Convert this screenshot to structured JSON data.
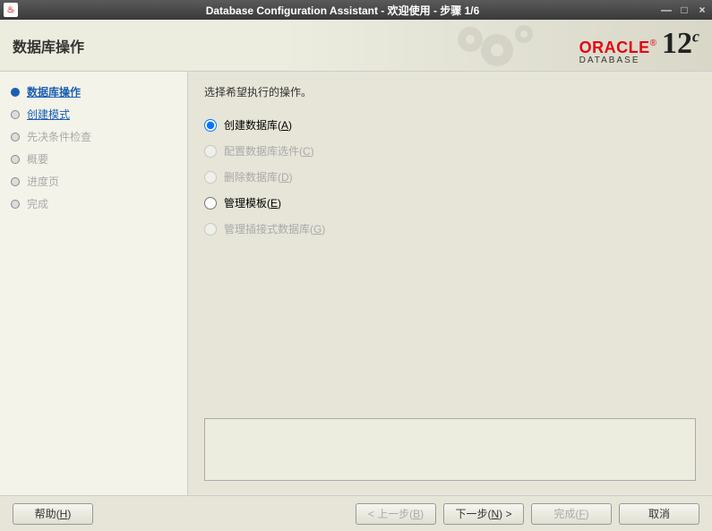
{
  "window": {
    "title": "Database Configuration Assistant - 欢迎使用 - 步骤 1/6"
  },
  "header": {
    "page_title": "数据库操作",
    "oracle": "ORACLE",
    "oracle_sub": "DATABASE",
    "version": "12",
    "version_sup": "c"
  },
  "sidebar": {
    "steps": [
      {
        "label": "数据库操作",
        "state": "active"
      },
      {
        "label": "创建模式",
        "state": "link"
      },
      {
        "label": "先决条件检查",
        "state": "disabled"
      },
      {
        "label": "概要",
        "state": "disabled"
      },
      {
        "label": "进度页",
        "state": "disabled"
      },
      {
        "label": "完成",
        "state": "disabled"
      }
    ]
  },
  "content": {
    "instruction": "选择希望执行的操作。",
    "options": [
      {
        "label": "创建数据库(",
        "key": "A",
        "tail": ")",
        "enabled": true,
        "selected": true
      },
      {
        "label": "配置数据库选件(",
        "key": "C",
        "tail": ")",
        "enabled": false,
        "selected": false
      },
      {
        "label": "删除数据库(",
        "key": "D",
        "tail": ")",
        "enabled": false,
        "selected": false
      },
      {
        "label": "管理模板(",
        "key": "E",
        "tail": ")",
        "enabled": true,
        "selected": false
      },
      {
        "label": "管理插接式数据库(",
        "key": "G",
        "tail": ")",
        "enabled": false,
        "selected": false
      }
    ]
  },
  "footer": {
    "help": "帮助(",
    "help_key": "H",
    "help_tail": ")",
    "back": "< 上一步(",
    "back_key": "B",
    "back_tail": ")",
    "next": "下一步(",
    "next_key": "N",
    "next_tail": ") >",
    "finish": "完成(",
    "finish_key": "F",
    "finish_tail": ")",
    "cancel": "取消"
  }
}
